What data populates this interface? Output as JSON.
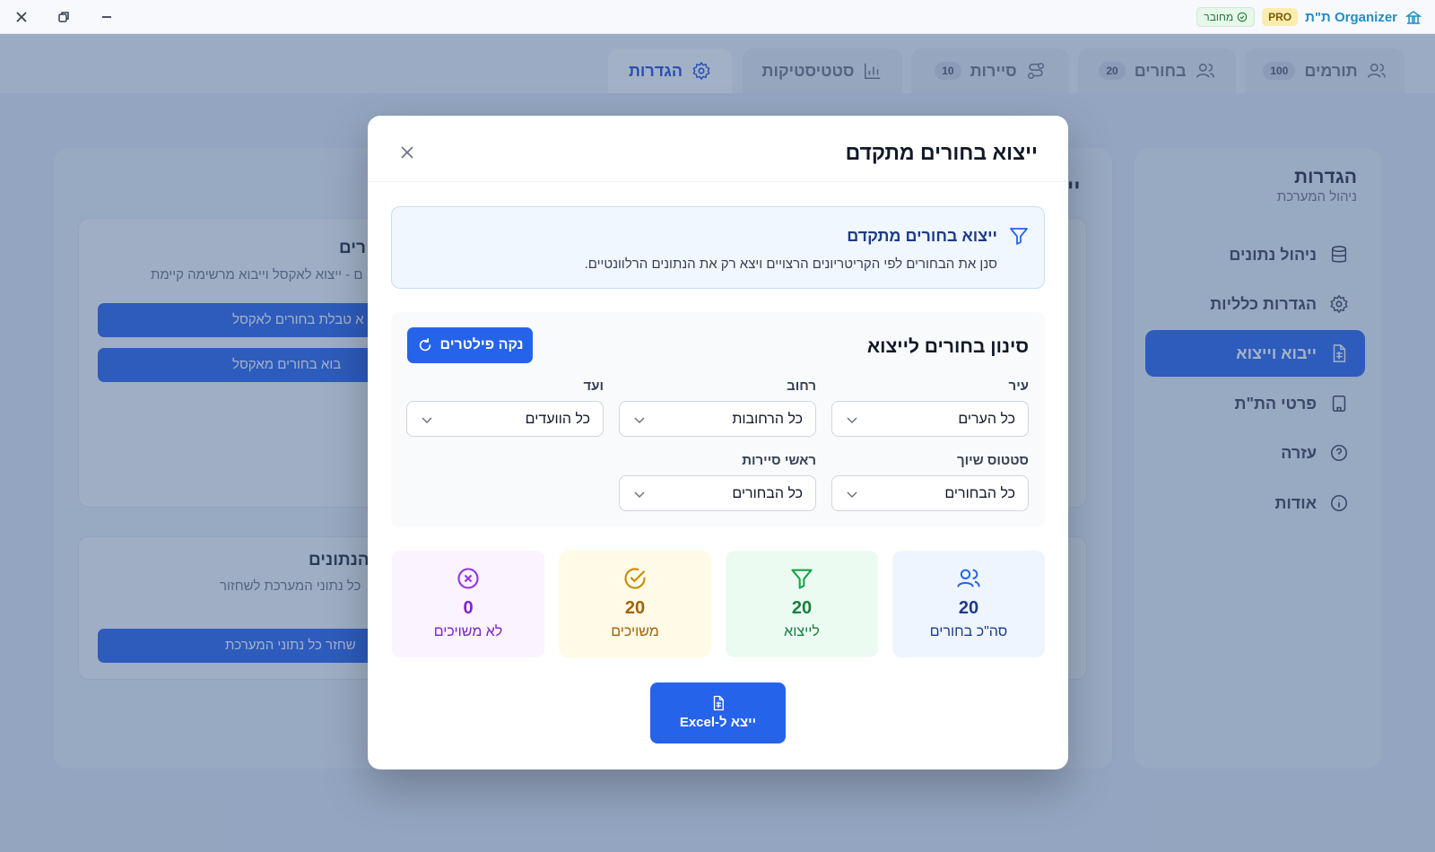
{
  "titlebar": {
    "app_name": "ת\"ת Organizer",
    "pro_badge": "PRO",
    "connection_status": "מחובר"
  },
  "tabs": [
    {
      "label": "תורמים",
      "count": "100"
    },
    {
      "label": "בחורים",
      "count": "20"
    },
    {
      "label": "סיירות",
      "count": "10"
    },
    {
      "label": "סטטיסטיקות"
    },
    {
      "label": "הגדרות"
    }
  ],
  "sidebar": {
    "title": "הגדרות",
    "subtitle": "ניהול המערכת",
    "items": [
      {
        "label": "ניהול נתונים",
        "icon": "database-icon"
      },
      {
        "label": "הגדרות כלליות",
        "icon": "gear-icon"
      },
      {
        "label": "ייבוא וייצוא",
        "icon": "file-spreadsheet-icon"
      },
      {
        "label": "פרטי הת\"ת",
        "icon": "building-icon"
      },
      {
        "label": "עזרה",
        "icon": "help-circle-icon"
      },
      {
        "label": "אודות",
        "icon": "info-icon"
      }
    ]
  },
  "background": {
    "main_heading": "יי",
    "card1_title": "רים",
    "card1_desc": "ם - ייצוא לאקסל וייבוא מרשימה קיימת",
    "card1_btn1": "א טבלת בחורים לאקסל",
    "card1_btn2": "בוא בחורים מאקסל",
    "card2_title": "הנתונים",
    "card2_desc": "כל נתוני המערכת לשחזור",
    "card2_btn": "שחזר כל נתוני המערכת"
  },
  "modal": {
    "title": "ייצוא בחורים מתקדם",
    "info_title": "ייצוא בחורים מתקדם",
    "info_desc": "סנן את הבחורים לפי הקריטריונים הרצויים ויצא רק את הנתונים הרלוונטיים.",
    "filter_title": "סינון בחורים לייצוא",
    "clear_label": "נקה פילטרים",
    "filters": {
      "city": {
        "label": "עיר",
        "value": "כל הערים"
      },
      "street": {
        "label": "רחוב",
        "value": "כל הרחובות"
      },
      "committee": {
        "label": "ועד",
        "value": "כל הוועדים"
      },
      "assignment": {
        "label": "סטטוס שיוך",
        "value": "כל הבחורים"
      },
      "patrol_heads": {
        "label": "ראשי סיירות",
        "value": "כל הבחורים"
      }
    },
    "stats": [
      {
        "value": "20",
        "label": "סה\"כ בחורים",
        "icon": "users-icon",
        "color": "#1e3a8a",
        "bg": "#eef5ff"
      },
      {
        "value": "20",
        "label": "לייצוא",
        "icon": "filter-icon",
        "color": "#15803d",
        "bg": "#ecfbf1"
      },
      {
        "value": "20",
        "label": "משויכים",
        "icon": "check-circle-icon",
        "color": "#a16207",
        "bg": "#fffbe6"
      },
      {
        "value": "0",
        "label": "לא משויכים",
        "icon": "x-circle-icon",
        "color": "#7e22ce",
        "bg": "#fbf3ff"
      }
    ],
    "export_label": "ייצא ל-Excel"
  }
}
